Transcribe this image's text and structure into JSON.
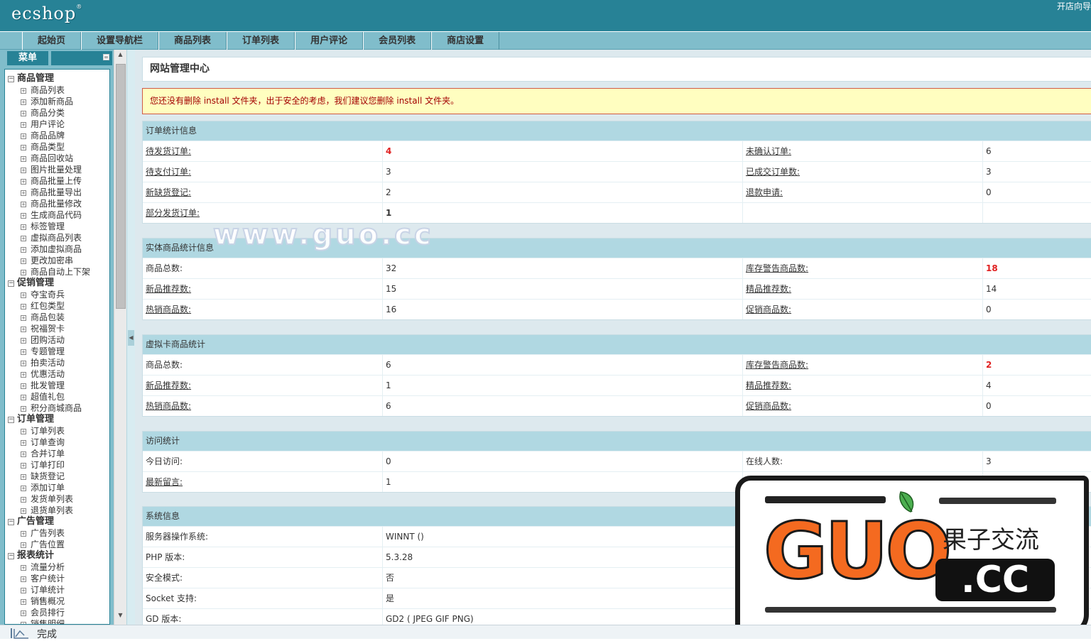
{
  "header": {
    "logo": "ecshop",
    "logo_mark": "®",
    "top_link": "开店向导"
  },
  "nav": [
    "起始页",
    "设置导航栏",
    "商品列表",
    "订单列表",
    "用户评论",
    "会员列表",
    "商店设置"
  ],
  "sidebar": {
    "menu_label": "菜单",
    "collapse_glyph": "=",
    "groups": [
      {
        "title": "商品管理",
        "items": [
          "商品列表",
          "添加新商品",
          "商品分类",
          "用户评论",
          "商品品牌",
          "商品类型",
          "商品回收站",
          "图片批量处理",
          "商品批量上传",
          "商品批量导出",
          "商品批量修改",
          "生成商品代码",
          "标签管理",
          "虚拟商品列表",
          "添加虚拟商品",
          "更改加密串",
          "商品自动上下架"
        ]
      },
      {
        "title": "促销管理",
        "items": [
          "夺宝奇兵",
          "红包类型",
          "商品包装",
          "祝福贺卡",
          "团购活动",
          "专题管理",
          "拍卖活动",
          "优惠活动",
          "批发管理",
          "超值礼包",
          "积分商城商品"
        ]
      },
      {
        "title": "订单管理",
        "items": [
          "订单列表",
          "订单查询",
          "合并订单",
          "订单打印",
          "缺货登记",
          "添加订单",
          "发货单列表",
          "退货单列表"
        ]
      },
      {
        "title": "广告管理",
        "items": [
          "广告列表",
          "广告位置"
        ]
      },
      {
        "title": "报表统计",
        "items": [
          "流量分析",
          "客户统计",
          "订单统计",
          "销售概况",
          "会员排行",
          "销售明细"
        ]
      }
    ]
  },
  "main": {
    "title": "网站管理中心",
    "warning": "您还没有删除 install 文件夹，出于安全的考虑，我们建议您删除 install 文件夹。",
    "order_stats": {
      "heading": "订单统计信息",
      "rows": [
        [
          "待发货订单:",
          "4",
          "未确认订单:",
          "6"
        ],
        [
          "待支付订单:",
          "3",
          "已成交订单数:",
          "3"
        ],
        [
          "新缺货登记:",
          "2",
          "退款申请:",
          "0"
        ],
        [
          "部分发货订单:",
          "1",
          "",
          ""
        ]
      ]
    },
    "goods_stats": {
      "heading": "实体商品统计信息",
      "rows": [
        [
          "商品总数:",
          "32",
          "库存警告商品数:",
          "18"
        ],
        [
          "新品推荐数:",
          "15",
          "精品推荐数:",
          "14"
        ],
        [
          "热销商品数:",
          "16",
          "促销商品数:",
          "0"
        ]
      ]
    },
    "virtual_stats": {
      "heading": "虚拟卡商品统计",
      "rows": [
        [
          "商品总数:",
          "6",
          "库存警告商品数:",
          "2"
        ],
        [
          "新品推荐数:",
          "1",
          "精品推荐数:",
          "4"
        ],
        [
          "热销商品数:",
          "6",
          "促销商品数:",
          "0"
        ]
      ]
    },
    "visit_stats": {
      "heading": "访问统计",
      "rows": [
        [
          "今日访问:",
          "0",
          "在线人数:",
          "3"
        ],
        [
          "最新留言:",
          "1",
          "",
          ""
        ]
      ]
    },
    "sys_info": {
      "heading": "系统信息",
      "rows": [
        [
          "服务器操作系统:",
          "WINNT ()"
        ],
        [
          "PHP 版本:",
          "5.3.28"
        ],
        [
          "安全模式:",
          "否"
        ],
        [
          "Socket 支持:",
          "是"
        ],
        [
          "GD 版本:",
          "GD2 ( JPEG GIF PNG)"
        ]
      ]
    }
  },
  "watermark": "www.guo.cc",
  "stamp": {
    "big": "GUO",
    "cn": "果子交流",
    "domain": ".CC"
  },
  "status_bar": {
    "text": "完成"
  },
  "colors": {
    "header": "#278296",
    "nav": "#80bdcb",
    "panel_head": "#b0d8e2",
    "main_bg": "#dde9ee",
    "alert": "#e02020",
    "stamp_orange": "#f46a20"
  }
}
